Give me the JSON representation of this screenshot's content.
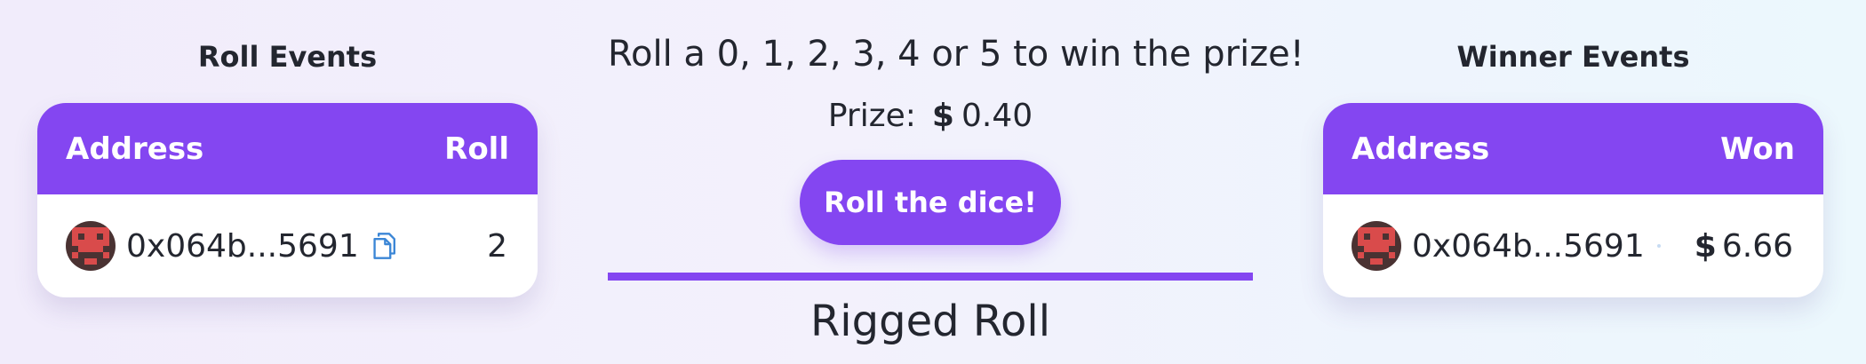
{
  "roll_events": {
    "title": "Roll Events",
    "columns": [
      "Address",
      "Roll"
    ],
    "rows": [
      {
        "address": "0x064b...5691",
        "roll": "2"
      }
    ]
  },
  "center": {
    "prompt": "Roll a 0, 1, 2, 3, 4 or 5 to win the prize!",
    "prize_label": "Prize:",
    "currency": "$",
    "prize_value": "0.40",
    "roll_button": "Roll the dice!",
    "section_title": "Rigged Roll"
  },
  "winner_events": {
    "title": "Winner Events",
    "columns": [
      "Address",
      "Won"
    ],
    "rows": [
      {
        "address": "0x064b...5691",
        "currency": "$",
        "won": "6.66"
      }
    ]
  },
  "colors": {
    "accent": "#8446f1",
    "text": "#23262f",
    "card": "#ffffff"
  },
  "icons": [
    "blockie-avatar",
    "copy-icon"
  ]
}
